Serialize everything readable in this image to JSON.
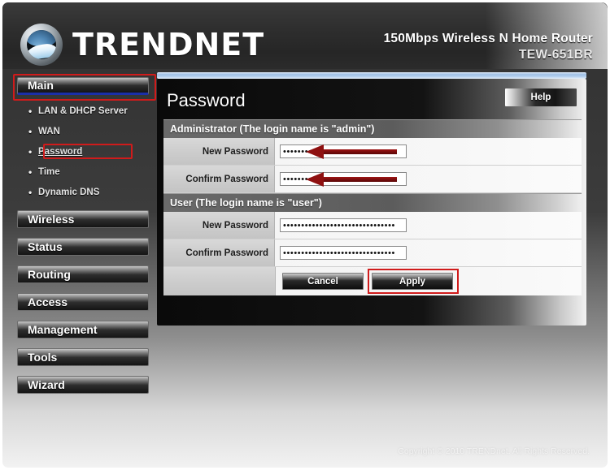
{
  "header": {
    "brand": "TRENDNET",
    "model_line1": "150Mbps Wireless N Home Router",
    "model_line2": "TEW-651BR",
    "logo_icon": "trendnet-globe-icon"
  },
  "sidebar": {
    "main_button": "Main",
    "submenu": [
      {
        "label": "LAN & DHCP Server",
        "selected": false
      },
      {
        "label": "WAN",
        "selected": false
      },
      {
        "label": "Password",
        "selected": true
      },
      {
        "label": "Time",
        "selected": false
      },
      {
        "label": "Dynamic DNS",
        "selected": false
      }
    ],
    "buttons": [
      {
        "label": "Wireless"
      },
      {
        "label": "Status"
      },
      {
        "label": "Routing"
      },
      {
        "label": "Access"
      },
      {
        "label": "Management"
      },
      {
        "label": "Tools"
      },
      {
        "label": "Wizard"
      }
    ]
  },
  "content": {
    "title": "Password",
    "help_label": "Help",
    "admin_section": {
      "heading": "Administrator (The login name is \"admin\")",
      "rows": [
        {
          "label": "New Password",
          "value": "•••••••••••••••••••••••••••••••",
          "placeholder": ""
        },
        {
          "label": "Confirm Password",
          "value": "•••••••••••••••••••••••••••••••",
          "placeholder": ""
        }
      ]
    },
    "user_section": {
      "heading": "User (The login name is \"user\")",
      "rows": [
        {
          "label": "New Password",
          "value": "•••••••••••••••••••••••••••••••",
          "placeholder": ""
        },
        {
          "label": "Confirm Password",
          "value": "•••••••••••••••••••••••••••••••",
          "placeholder": ""
        }
      ]
    },
    "cancel_label": "Cancel",
    "apply_label": "Apply"
  },
  "footer": {
    "copyright": "Copyright © 2010 TRENDnet. All Rights Reserved."
  },
  "annotations": {
    "highlight_color": "#d01b1b",
    "arrow_color": "#8e1010",
    "accent_blue": "#1b2fa8"
  }
}
